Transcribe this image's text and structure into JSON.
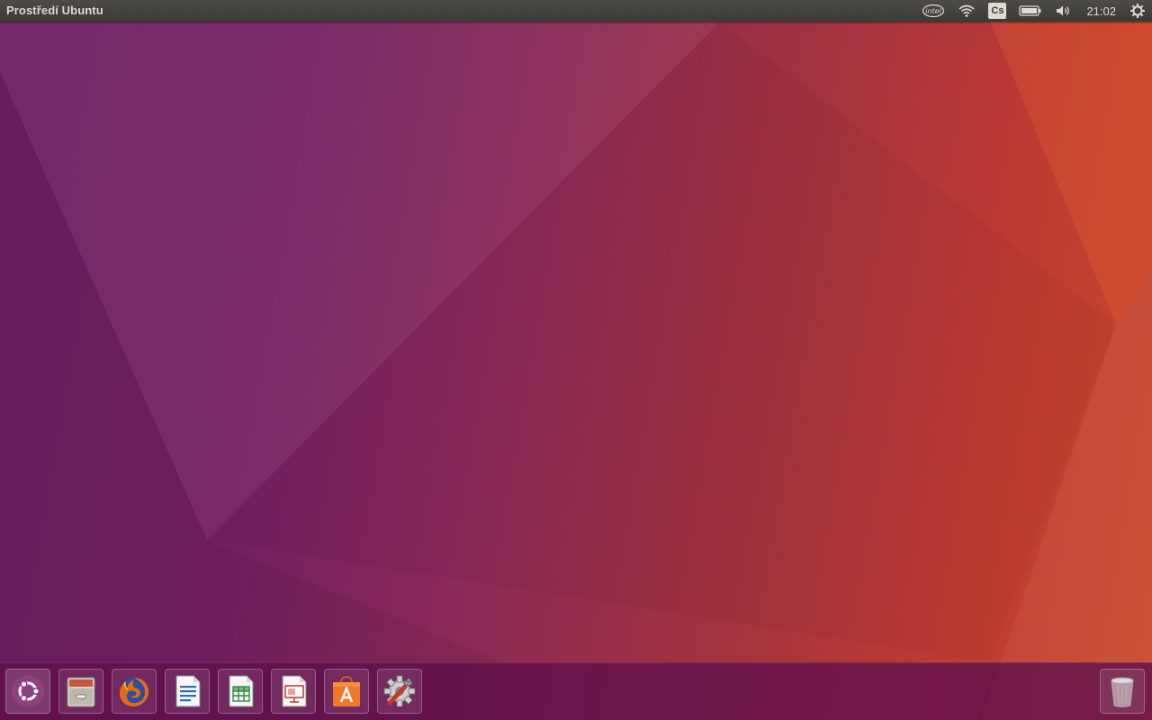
{
  "panel": {
    "title": "Prostředí Ubuntu",
    "clock": "21:02",
    "keyboard_layout": "Cs",
    "indicators": [
      "intel-icon",
      "wifi-icon",
      "keyboard-layout-indicator",
      "battery-icon",
      "volume-icon",
      "clock",
      "session-gear-icon"
    ]
  },
  "launcher": {
    "items": [
      {
        "name": "dash-home",
        "icon": "ubuntu-logo-icon"
      },
      {
        "name": "files",
        "icon": "file-cabinet-icon"
      },
      {
        "name": "firefox",
        "icon": "firefox-icon"
      },
      {
        "name": "libreoffice-writer",
        "icon": "writer-document-icon"
      },
      {
        "name": "libreoffice-calc",
        "icon": "calc-spreadsheet-icon"
      },
      {
        "name": "libreoffice-impress",
        "icon": "impress-presentation-icon"
      },
      {
        "name": "ubuntu-software",
        "icon": "software-store-icon"
      },
      {
        "name": "system-settings",
        "icon": "settings-wrench-gear-icon"
      }
    ],
    "trash": {
      "icon": "trash-icon"
    }
  },
  "colors": {
    "panel_bg": "#3b3a37",
    "panel_text": "#dfdbd2",
    "launcher_bg": "#5f0f4b",
    "wallpaper_left": "#6b1f63",
    "wallpaper_right": "#c94a2c",
    "ubuntu_orange": "#e95420"
  }
}
